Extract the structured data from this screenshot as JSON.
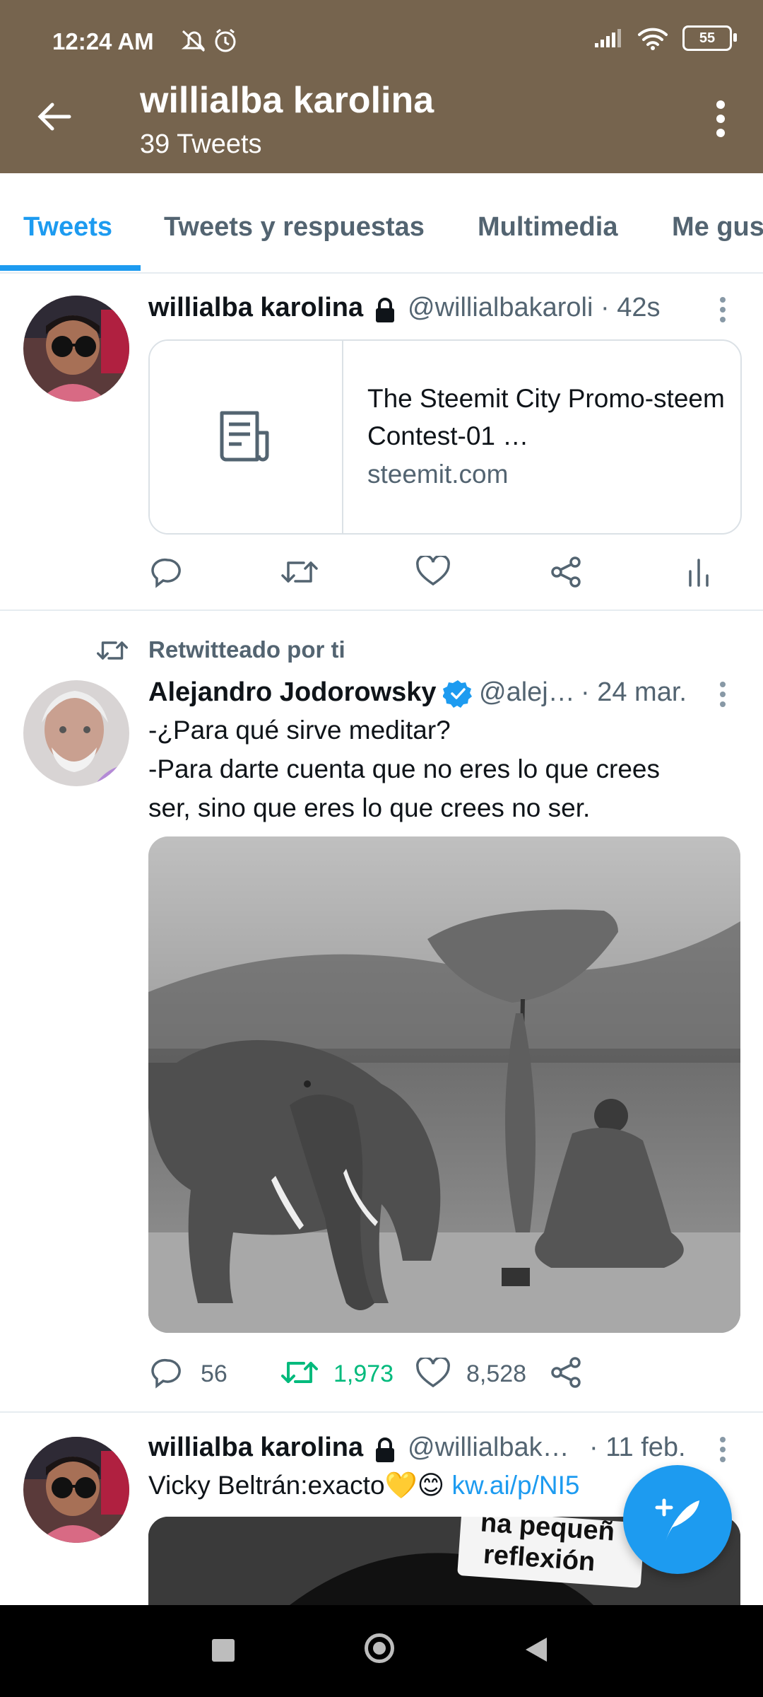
{
  "status_bar": {
    "time": "12:24 AM",
    "battery": "55"
  },
  "header": {
    "title": "willialba karolina",
    "subtitle": "39 Tweets"
  },
  "tabs": [
    {
      "label": "Tweets"
    },
    {
      "label": "Tweets y respuestas"
    },
    {
      "label": "Multimedia"
    },
    {
      "label": "Me gus"
    }
  ],
  "tweet1": {
    "name": "willialba karolina",
    "handle_time": "@willialbakaroli · 42s",
    "card": {
      "title": "The Steemit City Promo-steem Contest-01 …",
      "domain": "steemit.com"
    }
  },
  "tweet2": {
    "retweet_label": "Retwitteado por ti",
    "name": "Alejandro Jodorowsky",
    "handle": "@alej…",
    "time": "· 24 mar.",
    "text_line1": "-¿Para qué sirve meditar?",
    "text_line2": "-Para darte cuenta que no eres lo que crees",
    "text_line3": "ser, sino que eres lo que crees no ser.",
    "replies": "56",
    "retweets": "1,973",
    "likes": "8,528"
  },
  "tweet3": {
    "name": "willialba karolina",
    "handle": "@willialbak…",
    "time": "· 11 feb.",
    "text": "Vicky Beltrán:exacto💛😊",
    "link": "kw.ai/p/NI5",
    "image_caption_1": "na pequeñ",
    "image_caption_2": "reflexión"
  },
  "colors": {
    "header": "#76644e",
    "accent": "#1d9bf0",
    "retweet_green": "#00ba7c",
    "muted": "#536471"
  },
  "icons": [
    "back-arrow-icon",
    "more-vertical-icon",
    "lock-icon",
    "verified-icon",
    "reply-icon",
    "retweet-icon",
    "like-icon",
    "share-icon",
    "analytics-icon",
    "compose-icon"
  ]
}
